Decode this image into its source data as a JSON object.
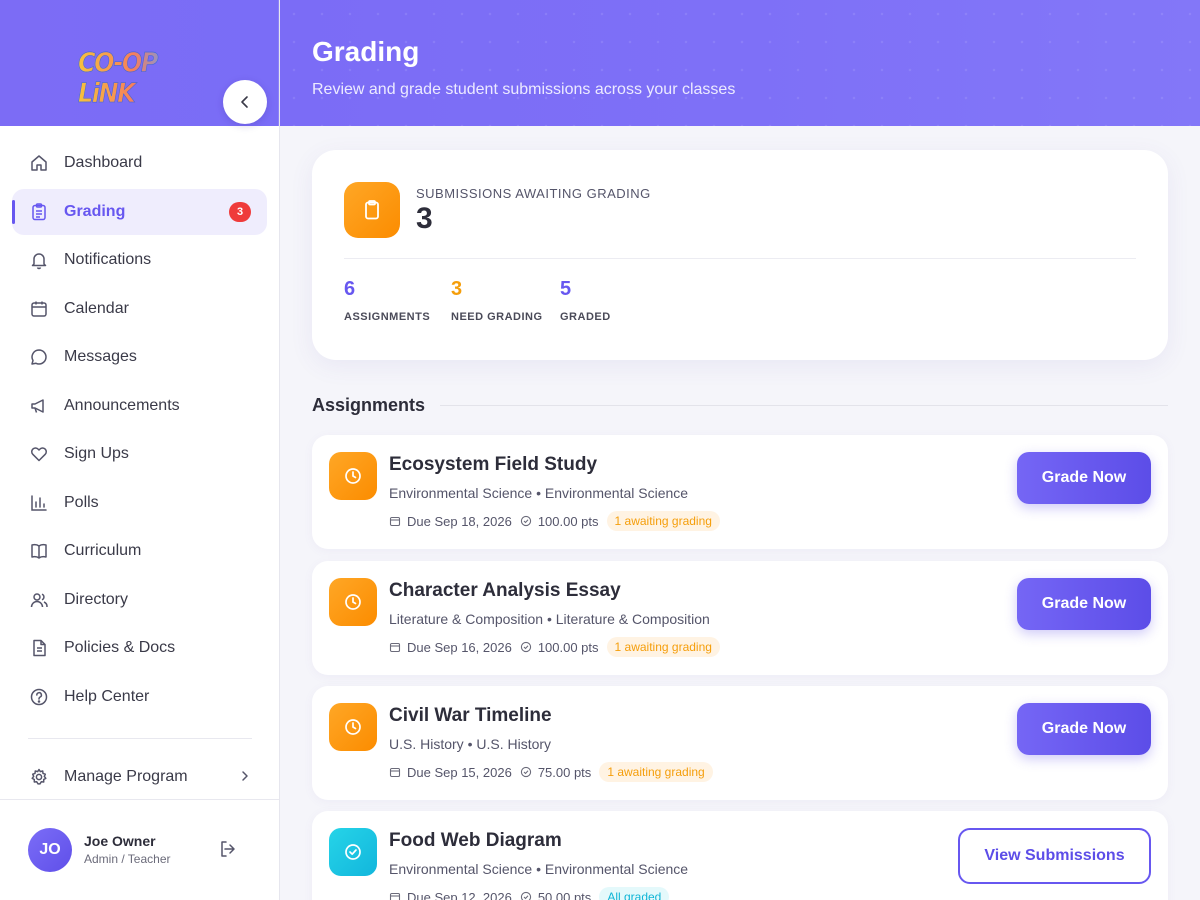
{
  "app": {
    "logo_text": "CO-OP LiNK",
    "brand_color": "#6757f0"
  },
  "sidebar": {
    "items": [
      {
        "label": "Dashboard",
        "icon": "home-icon"
      },
      {
        "label": "Grading",
        "icon": "clipboard-icon",
        "badge": "3",
        "active": true
      },
      {
        "label": "Notifications",
        "icon": "bell-icon"
      },
      {
        "label": "Calendar",
        "icon": "calendar-icon"
      },
      {
        "label": "Messages",
        "icon": "chat-bubble-icon"
      },
      {
        "label": "Announcements",
        "icon": "megaphone-icon"
      },
      {
        "label": "Sign Ups",
        "icon": "heart-icon"
      },
      {
        "label": "Polls",
        "icon": "bar-chart-icon"
      },
      {
        "label": "Curriculum",
        "icon": "book-icon"
      },
      {
        "label": "Directory",
        "icon": "users-icon"
      },
      {
        "label": "Policies & Docs",
        "icon": "document-icon"
      },
      {
        "label": "Help Center",
        "icon": "help-circle-icon"
      }
    ],
    "manage": {
      "label": "Manage Program",
      "icon": "gear-icon"
    },
    "user": {
      "initials": "JO",
      "name": "Joe Owner",
      "role": "Admin / Teacher"
    }
  },
  "header": {
    "title": "Grading",
    "subtitle": "Review and grade student submissions across your classes"
  },
  "summary": {
    "label": "SUBMISSIONS AWAITING GRADING",
    "count": "3",
    "stats": [
      {
        "value": "6",
        "label": "ASSIGNMENTS",
        "color": "#6757f0"
      },
      {
        "value": "3",
        "label": "NEED GRADING",
        "color": "#f59e0b"
      },
      {
        "value": "5",
        "label": "GRADED",
        "color": "#6757f0"
      }
    ]
  },
  "assignments_section": {
    "title": "Assignments",
    "items": [
      {
        "title": "Ecosystem Field Study",
        "subject": "Environmental Science • Environmental Science",
        "due": "Due Sep 18, 2026",
        "points": "100.00 pts",
        "status": "1 awaiting grading",
        "action": "Grade Now"
      },
      {
        "title": "Character Analysis Essay",
        "subject": "Literature & Composition • Literature & Composition",
        "due": "Due Sep 16, 2026",
        "points": "100.00 pts",
        "status": "1 awaiting grading",
        "action": "Grade Now"
      },
      {
        "title": "Civil War Timeline",
        "subject": "U.S. History • U.S. History",
        "due": "Due Sep 15, 2026",
        "points": "75.00 pts",
        "status": "1 awaiting grading",
        "action": "Grade Now"
      },
      {
        "title": "Food Web Diagram",
        "subject": "Environmental Science • Environmental Science",
        "due": "Due Sep 12, 2026",
        "points": "50.00 pts",
        "status": "All graded",
        "action": "View Submissions"
      }
    ]
  }
}
